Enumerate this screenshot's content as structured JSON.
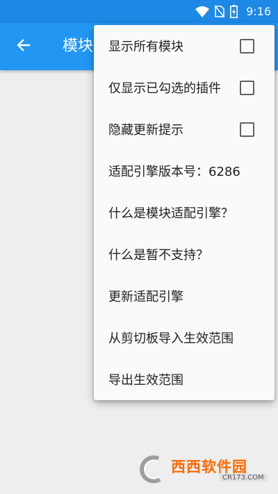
{
  "status_bar": {
    "time": "9:16",
    "icons": [
      "wifi-icon",
      "no-sim-icon",
      "battery-charging-icon"
    ]
  },
  "app_bar": {
    "back_icon": "arrow-left-icon",
    "title": "模块"
  },
  "menu": {
    "items": [
      {
        "label": "显示所有模块",
        "checkbox": true,
        "checked": false
      },
      {
        "label": "仅显示已勾选的插件",
        "checkbox": true,
        "checked": false
      },
      {
        "label": "隐藏更新提示",
        "checkbox": true,
        "checked": false
      },
      {
        "label": "适配引擎版本号：6286",
        "checkbox": false
      },
      {
        "label": "什么是模块适配引擎？",
        "checkbox": false
      },
      {
        "label": "什么是暂不支持？",
        "checkbox": false
      },
      {
        "label": "更新适配引擎",
        "checkbox": false
      },
      {
        "label": "从剪切板导入生效范围",
        "checkbox": false
      },
      {
        "label": "导出生效范围",
        "checkbox": false
      }
    ]
  },
  "watermark": {
    "text": "西西软件园",
    "url": "CR173.COM"
  },
  "colors": {
    "status_bar": "#1e88e5",
    "app_bar": "#2196f3",
    "background": "#eeeeee",
    "menu_background": "#fafafa"
  }
}
